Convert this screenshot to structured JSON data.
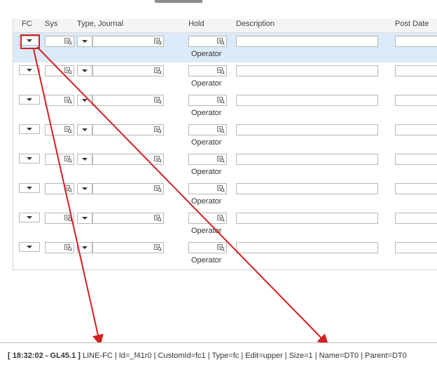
{
  "grid": {
    "headers": {
      "fc": "FC",
      "sys": "Sys",
      "type_journal": "Type, Journal",
      "hold": "Hold",
      "description": "Description",
      "post_date": "Post Date"
    },
    "rows": [
      {
        "operator": "Operator",
        "selected": true
      },
      {
        "operator": "Operator",
        "selected": false
      },
      {
        "operator": "Operator",
        "selected": false
      },
      {
        "operator": "Operator",
        "selected": false
      },
      {
        "operator": "Operator",
        "selected": false
      },
      {
        "operator": "Operator",
        "selected": false
      },
      {
        "operator": "Operator",
        "selected": false
      },
      {
        "operator": "Operator",
        "selected": false
      }
    ]
  },
  "status": {
    "time_screen": "[ 18:32:02 - GL45.1 ]",
    "details": " LINE-FC | Id=_f41r0 | CustomId=fc1 | Type=fc | Edit=upper | Size=1 | Name=DT0 | Parent=DT0"
  },
  "icons": [
    "chevron-down-icon",
    "lookup-icon"
  ],
  "colors": {
    "annotation": "#d42020",
    "selected_row": "#dbeaf8"
  }
}
